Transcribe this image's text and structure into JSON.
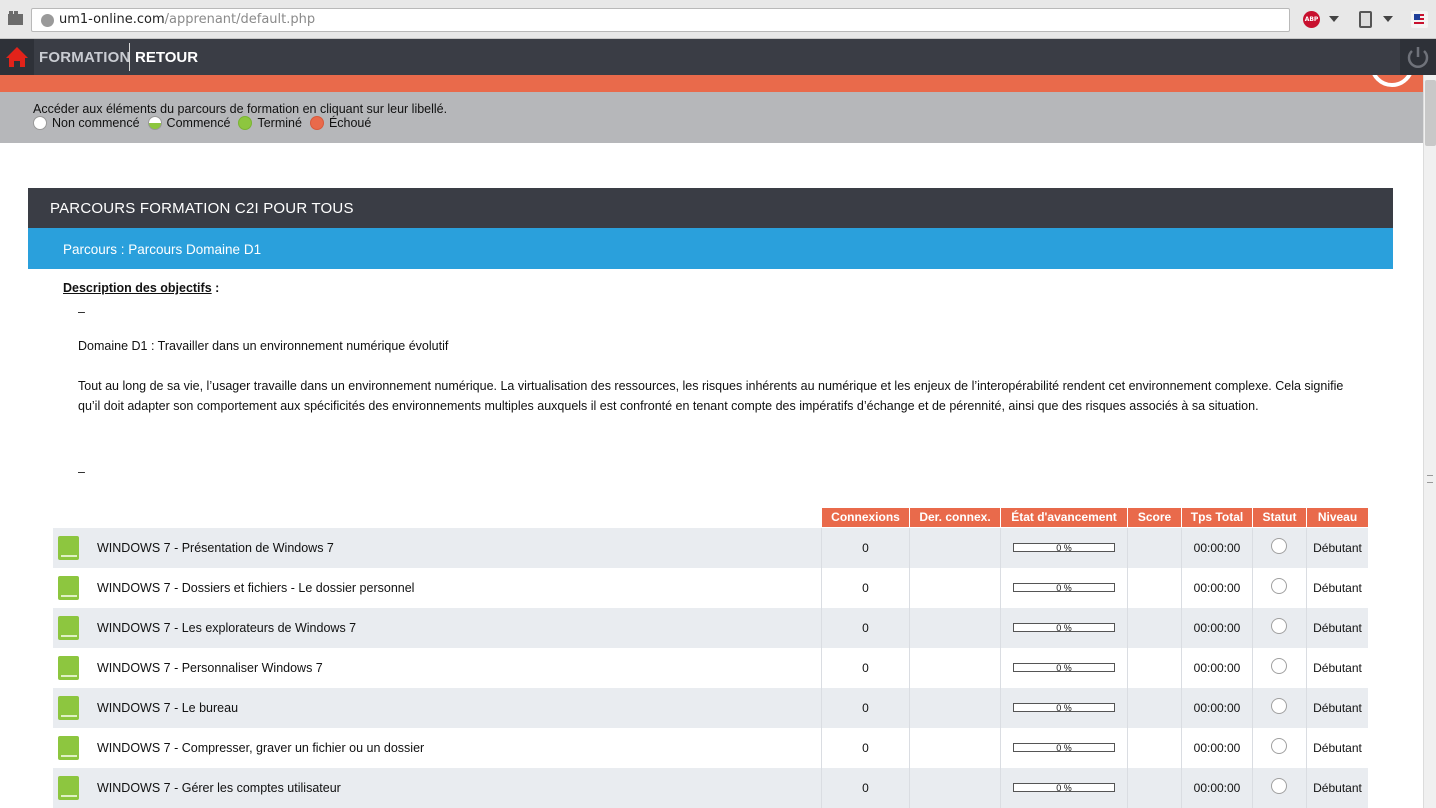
{
  "browser": {
    "url_host": "um1-online.com",
    "url_path": "/apprenant/default.php"
  },
  "nav": {
    "formation": "FORMATION",
    "retour": "RETOUR"
  },
  "legend": {
    "instructions": "Accéder aux éléments du parcours de formation en cliquant sur leur libellé.",
    "items": [
      "Non commencé",
      "Commencé",
      "Terminé",
      "Échoué"
    ],
    "colors": {
      "completed": "#8dc63f",
      "failed": "#e96a4b"
    }
  },
  "parcours": {
    "title": "PARCOURS FORMATION C2I POUR TOUS",
    "subtitle": "Parcours : Parcours Domaine D1"
  },
  "description": {
    "label": "Description des objectifs",
    "dash1": "–",
    "domain_line": "Domaine D1 : Travailler dans un environnement numérique évolutif",
    "paragraph": "Tout au long de sa vie, l’usager travaille dans un environnement numérique. La virtualisation des ressources, les risques inhérents au numérique et les enjeux de l’interopérabilité rendent cet environnement complexe. Cela signifie qu’il doit adapter son comportement aux spécificités des environnements multiples auxquels il est confronté en tenant compte des impératifs d’échange et de pérennité, ainsi que des risques associés à sa situation.",
    "dash2": "–"
  },
  "table": {
    "headers": [
      "Connexions",
      "Der. connex.",
      "État d'avancement",
      "Score",
      "Tps Total",
      "Statut",
      "Niveau"
    ],
    "rows": [
      {
        "title": "WINDOWS 7 - Présentation de Windows 7",
        "connexions": "0",
        "last": "",
        "progress": "0 %",
        "score": "",
        "total": "00:00:00",
        "niveau": "Débutant"
      },
      {
        "title": "WINDOWS 7 - Dossiers et fichiers - Le dossier personnel",
        "connexions": "0",
        "last": "",
        "progress": "0 %",
        "score": "",
        "total": "00:00:00",
        "niveau": "Débutant"
      },
      {
        "title": "WINDOWS 7 - Les explorateurs de Windows 7",
        "connexions": "0",
        "last": "",
        "progress": "0 %",
        "score": "",
        "total": "00:00:00",
        "niveau": "Débutant"
      },
      {
        "title": "WINDOWS 7 - Personnaliser Windows 7",
        "connexions": "0",
        "last": "",
        "progress": "0 %",
        "score": "",
        "total": "00:00:00",
        "niveau": "Débutant"
      },
      {
        "title": "WINDOWS 7 - Le bureau",
        "connexions": "0",
        "last": "",
        "progress": "0 %",
        "score": "",
        "total": "00:00:00",
        "niveau": "Débutant"
      },
      {
        "title": "WINDOWS 7 - Compresser, graver un fichier ou un dossier",
        "connexions": "0",
        "last": "",
        "progress": "0 %",
        "score": "",
        "total": "00:00:00",
        "niveau": "Débutant"
      },
      {
        "title": "WINDOWS 7 - Gérer les comptes utilisateur",
        "connexions": "0",
        "last": "",
        "progress": "0 %",
        "score": "",
        "total": "00:00:00",
        "niveau": "Débutant"
      }
    ]
  }
}
